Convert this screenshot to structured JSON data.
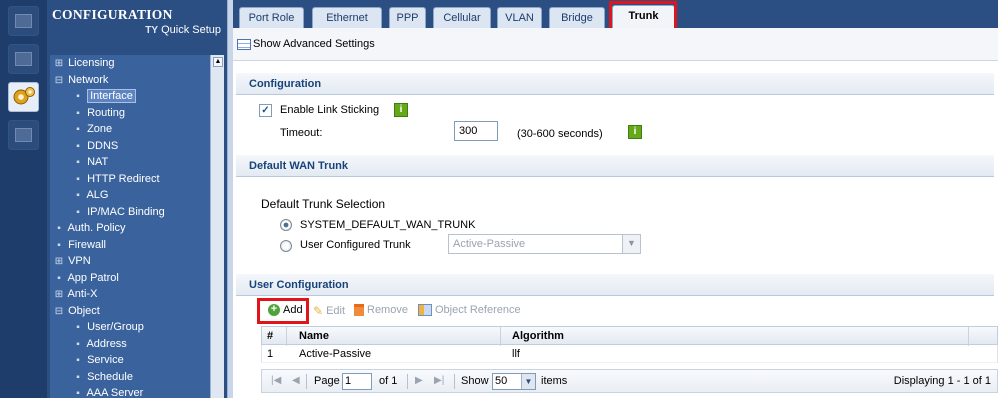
{
  "nav": {
    "title": "CONFIGURATION",
    "quick_setup": "Quick Setup",
    "items": [
      {
        "label": "Licensing",
        "marker": "⊞",
        "level": 0
      },
      {
        "label": "Network",
        "marker": "⊟",
        "level": 0
      },
      {
        "label": "Interface",
        "marker": "▪",
        "level": 1,
        "selected": true
      },
      {
        "label": "Routing",
        "marker": "▪",
        "level": 1
      },
      {
        "label": "Zone",
        "marker": "▪",
        "level": 1
      },
      {
        "label": "DDNS",
        "marker": "▪",
        "level": 1
      },
      {
        "label": "NAT",
        "marker": "▪",
        "level": 1
      },
      {
        "label": "HTTP Redirect",
        "marker": "▪",
        "level": 1
      },
      {
        "label": "ALG",
        "marker": "▪",
        "level": 1
      },
      {
        "label": "IP/MAC Binding",
        "marker": "▪",
        "level": 1
      },
      {
        "label": "Auth. Policy",
        "marker": "▪",
        "level": 0
      },
      {
        "label": "Firewall",
        "marker": "▪",
        "level": 0
      },
      {
        "label": "VPN",
        "marker": "⊞",
        "level": 0
      },
      {
        "label": "App Patrol",
        "marker": "▪",
        "level": 0
      },
      {
        "label": "Anti-X",
        "marker": "⊞",
        "level": 0
      },
      {
        "label": "Object",
        "marker": "⊟",
        "level": 0
      },
      {
        "label": "User/Group",
        "marker": "▪",
        "level": 1
      },
      {
        "label": "Address",
        "marker": "▪",
        "level": 1
      },
      {
        "label": "Service",
        "marker": "▪",
        "level": 1
      },
      {
        "label": "Schedule",
        "marker": "▪",
        "level": 1
      },
      {
        "label": "AAA Server",
        "marker": "▪",
        "level": 1
      }
    ]
  },
  "tabs": [
    {
      "label": "Port Role"
    },
    {
      "label": "Ethernet"
    },
    {
      "label": "PPP"
    },
    {
      "label": "Cellular"
    },
    {
      "label": "VLAN"
    },
    {
      "label": "Bridge"
    },
    {
      "label": "Trunk",
      "active": true
    }
  ],
  "advanced": {
    "label": "Show Advanced Settings"
  },
  "configuration": {
    "heading": "Configuration",
    "enable_link_sticking": {
      "label": "Enable Link Sticking",
      "checked": true
    },
    "timeout": {
      "label": "Timeout:",
      "value": "300",
      "range": "(30-600 seconds)"
    }
  },
  "default_wan": {
    "heading": "Default WAN Trunk",
    "selection_label": "Default Trunk Selection",
    "option_default": "SYSTEM_DEFAULT_WAN_TRUNK",
    "option_user": "User Configured Trunk",
    "user_trunk_select": "Active-Passive"
  },
  "user_config": {
    "heading": "User Configuration",
    "toolbar": {
      "add": "Add",
      "edit": "Edit",
      "remove": "Remove",
      "object_reference": "Object Reference"
    },
    "columns": {
      "num": "#",
      "name": "Name",
      "algorithm": "Algorithm"
    },
    "rows": [
      {
        "num": "1",
        "name": "Active-Passive",
        "algorithm": "llf"
      }
    ],
    "pager": {
      "page_label": "Page",
      "page_value": "1",
      "of_label": "of 1",
      "show_label": "Show",
      "show_value": "50",
      "items_label": "items",
      "displaying": "Displaying 1 - 1 of 1"
    }
  },
  "colors": {
    "nav_bg": "#2b4f82",
    "highlight_red": "#e0141b",
    "section_heading": "#17437a",
    "info_green": "#65a81a"
  }
}
